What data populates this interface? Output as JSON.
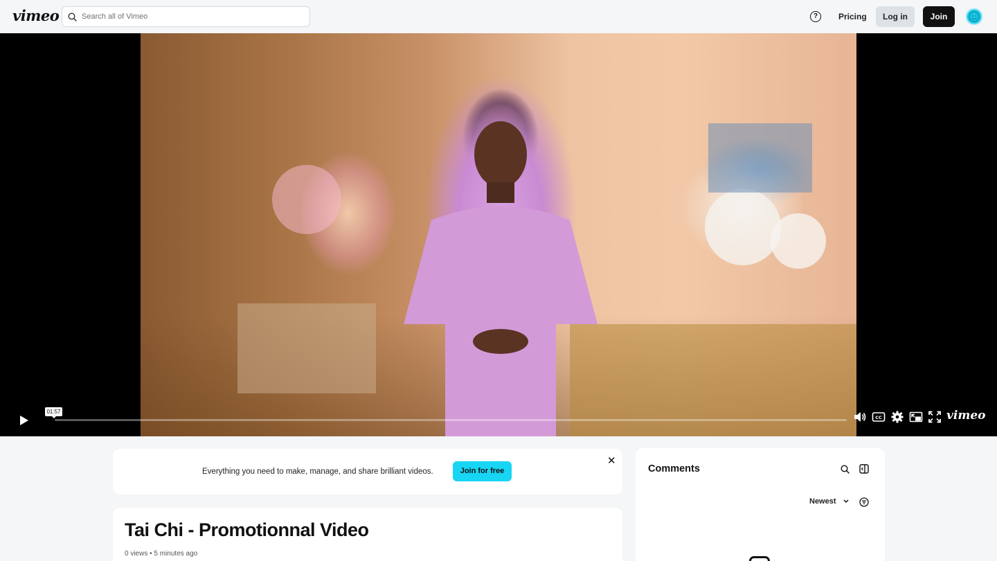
{
  "header": {
    "logo": "vimeo",
    "search_placeholder": "Search all of Vimeo",
    "help_glyph": "?",
    "pricing": "Pricing",
    "login": "Log in",
    "join": "Join"
  },
  "player": {
    "timecode": "01:57",
    "progress": 0.0,
    "brand": "vimeo"
  },
  "banner": {
    "text": "Everything you need to make, manage, and share brilliant videos.",
    "button": "Join for free",
    "close_glyph": "✕"
  },
  "video": {
    "title": "Tai Chi - Promotionnal Video",
    "meta": "0 views • 5 minutes ago"
  },
  "comments": {
    "title": "Comments",
    "sort_label": "Newest"
  },
  "colors": {
    "accent": "#17d5f3",
    "dark": "#111111",
    "background": "#f4f6f8"
  }
}
